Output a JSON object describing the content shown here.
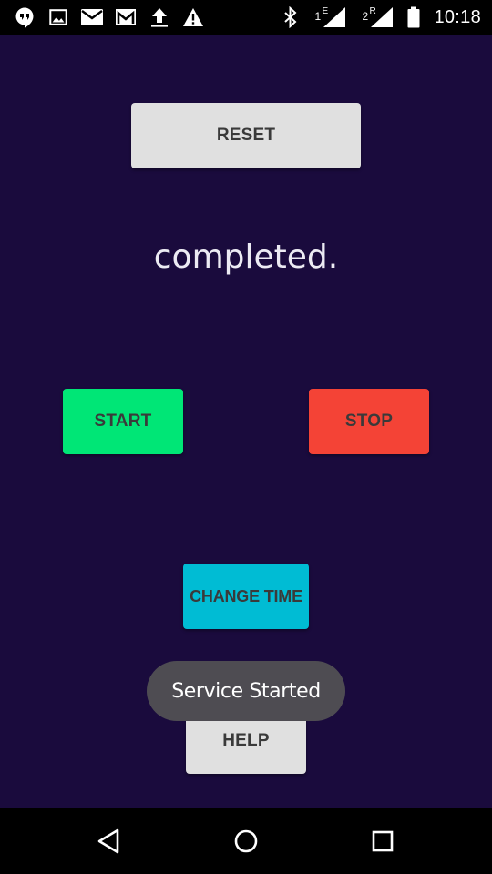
{
  "status_bar": {
    "time": "10:18",
    "sim1_label": "1",
    "sim1_network": "E",
    "sim2_label": "2",
    "sim2_network": "R",
    "left_icons": [
      "hangouts-icon",
      "image-icon",
      "mail-icon",
      "gmail-icon",
      "upload-icon",
      "warning-icon"
    ],
    "right_icons": [
      "bluetooth-icon",
      "signal-sim1-icon",
      "signal-sim2-icon",
      "battery-icon"
    ]
  },
  "app": {
    "background": "#1a0b3d",
    "reset_label": "RESET",
    "status_text": "completed.",
    "start_label": "START",
    "stop_label": "STOP",
    "change_time_label": "CHANGE TIME",
    "help_label": "HELP",
    "toast_text": "Service Started",
    "colors": {
      "reset": "#e0e0e0",
      "start": "#00e676",
      "stop": "#f44336",
      "change_time": "#00bcd4",
      "help": "#e0e0e0",
      "toast": "#4e4c52"
    }
  },
  "nav_bar": {
    "buttons": [
      "back-icon",
      "home-icon",
      "recents-icon"
    ]
  }
}
